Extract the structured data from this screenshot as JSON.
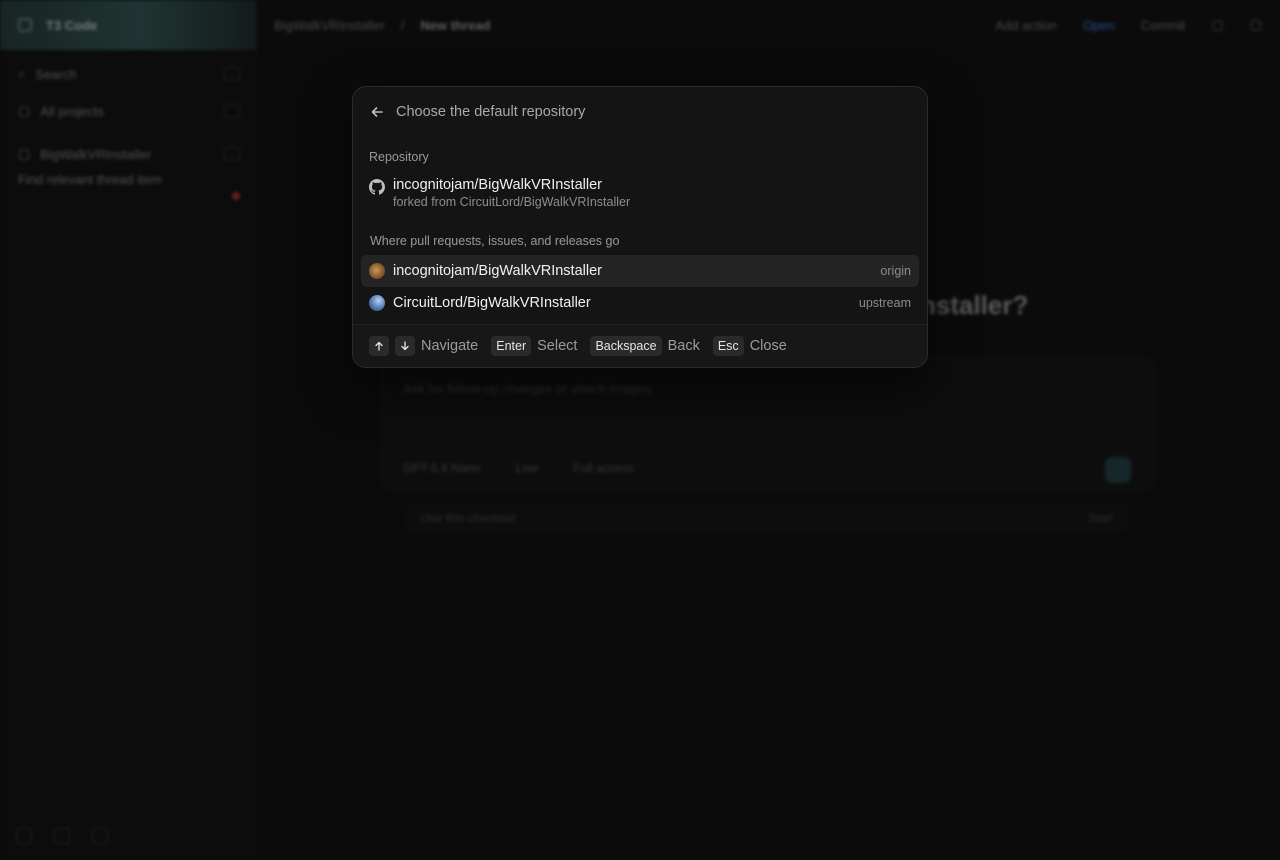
{
  "background": {
    "sidebar": {
      "app_title": "T3 Code",
      "search_label": "Search",
      "all_projects_label": "All projects",
      "project_name": "BigWalkVRInstaller",
      "thread_preview": "Find relevant thread item"
    },
    "topbar": {
      "breadcrumb_project": "BigWalkVRInstaller",
      "breadcrumb_thread": "New thread",
      "add_action_label": "Add action",
      "open_label": "Open",
      "commit_label": "Commit"
    },
    "heading_fragment": "nstaller?",
    "composer": {
      "placeholder": "Ask for follow-up changes or attach images",
      "model_label": "GPT-5.4 Nano",
      "mode_label": "Low",
      "access_label": "Full access",
      "footer_left": "Use this checkout",
      "footer_right": "Start"
    }
  },
  "modal": {
    "title": "Choose the default repository",
    "repository_section_label": "Repository",
    "current_repo": {
      "name": "incognitojam/BigWalkVRInstaller",
      "subtitle": "forked from CircuitLord/BigWalkVRInstaller",
      "icon": "github-icon"
    },
    "target_section_label": "Where pull requests, issues, and releases go",
    "options": [
      {
        "name": "incognitojam/BigWalkVRInstaller",
        "tag": "origin",
        "selected": true
      },
      {
        "name": "CircuitLord/BigWalkVRInstaller",
        "tag": "upstream",
        "selected": false
      }
    ],
    "footer": {
      "navigate_label": "Navigate",
      "enter_key": "Enter",
      "select_label": "Select",
      "backspace_key": "Backspace",
      "back_label": "Back",
      "esc_key": "Esc",
      "close_label": "Close"
    }
  },
  "colors": {
    "modal_bg": "#141414",
    "selected_row_bg": "#242424",
    "accent_blue": "#3b82f6"
  }
}
